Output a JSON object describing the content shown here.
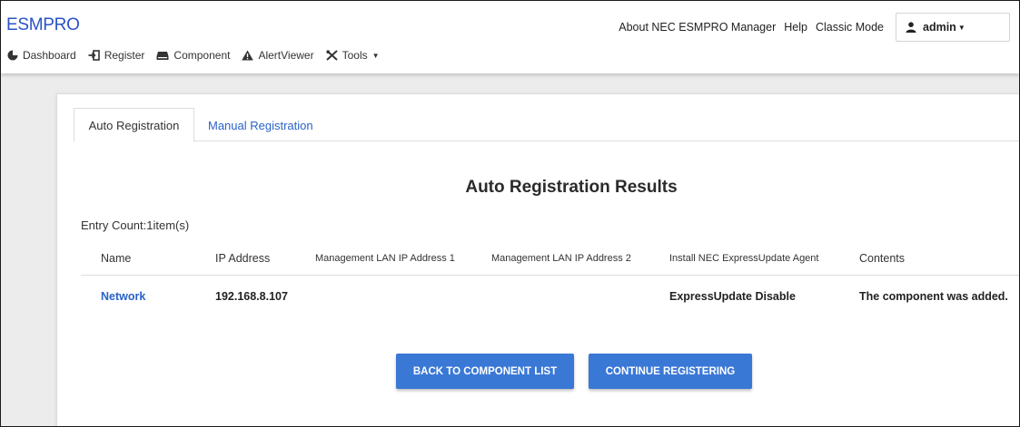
{
  "brand": "ESMPRO",
  "top_links": {
    "about": "About NEC ESMPRO Manager",
    "help": "Help",
    "classic": "Classic Mode",
    "user": "admin"
  },
  "nav": [
    {
      "label": "Dashboard",
      "icon": "dashboard-icon"
    },
    {
      "label": "Register",
      "icon": "register-icon"
    },
    {
      "label": "Component",
      "icon": "component-icon"
    },
    {
      "label": "AlertViewer",
      "icon": "alert-icon"
    },
    {
      "label": "Tools",
      "icon": "tools-icon"
    }
  ],
  "tabs": {
    "auto": "Auto Registration",
    "manual": "Manual Registration"
  },
  "results": {
    "title": "Auto Registration Results",
    "entry_count": "Entry Count:1item(s)",
    "columns": [
      "Name",
      "IP Address",
      "Management LAN IP Address 1",
      "Management LAN IP Address 2",
      "Install NEC ExpressUpdate Agent",
      "Contents"
    ],
    "rows": [
      {
        "name": "Network",
        "ip": "192.168.8.107",
        "mgmt1": "",
        "mgmt2": "",
        "agent": "ExpressUpdate Disable",
        "contents": "The component was added."
      }
    ]
  },
  "buttons": {
    "back": "BACK TO COMPONENT LIST",
    "continue": "CONTINUE REGISTERING"
  },
  "colors": {
    "brand": "#2a52c9",
    "link": "#2a62c9",
    "button": "#3a78d6"
  }
}
